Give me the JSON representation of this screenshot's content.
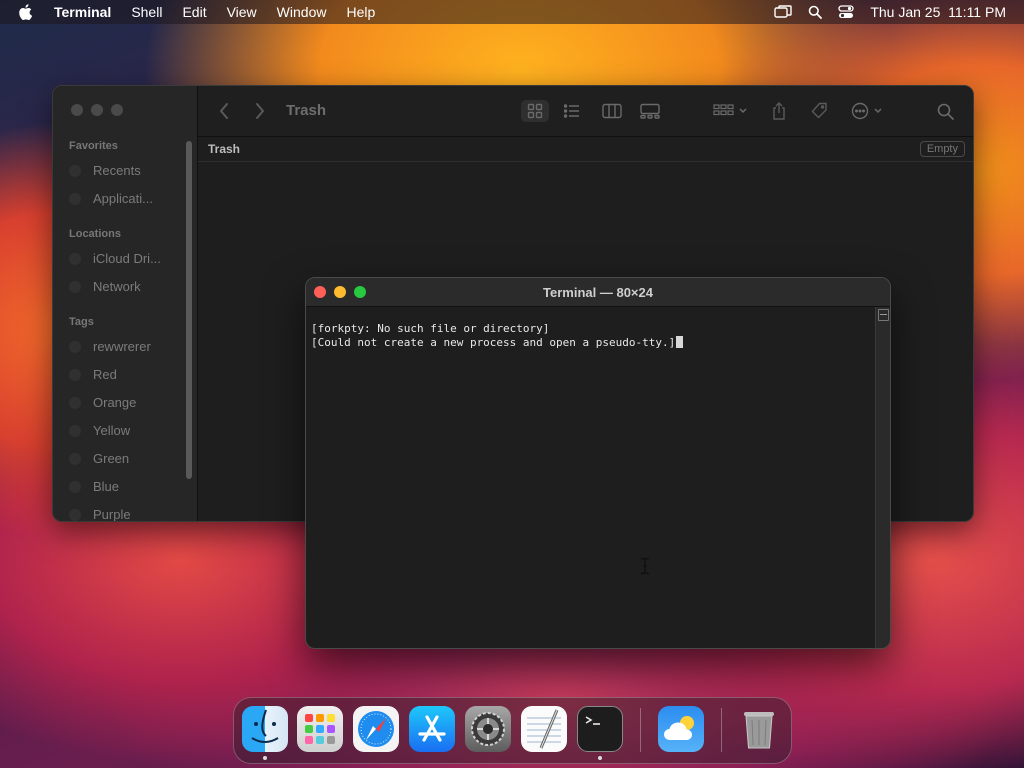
{
  "menubar": {
    "app_name": "Terminal",
    "items": [
      "Shell",
      "Edit",
      "View",
      "Window",
      "Help"
    ],
    "datetime": "Thu Jan 25  11:11 PM"
  },
  "finder": {
    "sidebar": {
      "favorites_header": "Favorites",
      "favorites": [
        "Recents",
        "Applicati..."
      ],
      "locations_header": "Locations",
      "locations": [
        "iCloud Dri...",
        "Network"
      ],
      "tags_header": "Tags",
      "tags": [
        "rewwrerer",
        "Red",
        "Orange",
        "Yellow",
        "Green",
        "Blue",
        "Purple"
      ]
    },
    "title": "Trash",
    "path_label": "Trash",
    "empty_button": "Empty"
  },
  "terminal": {
    "title": "Terminal — 80×24",
    "lines": [
      "[forkpty: No such file or directory]",
      "[Could not create a new process and open a pseudo-tty.]"
    ]
  },
  "dock": {
    "apps": [
      "finder",
      "launchpad",
      "safari",
      "app-store",
      "system-settings",
      "textedit",
      "terminal",
      "weather",
      "trash"
    ]
  }
}
